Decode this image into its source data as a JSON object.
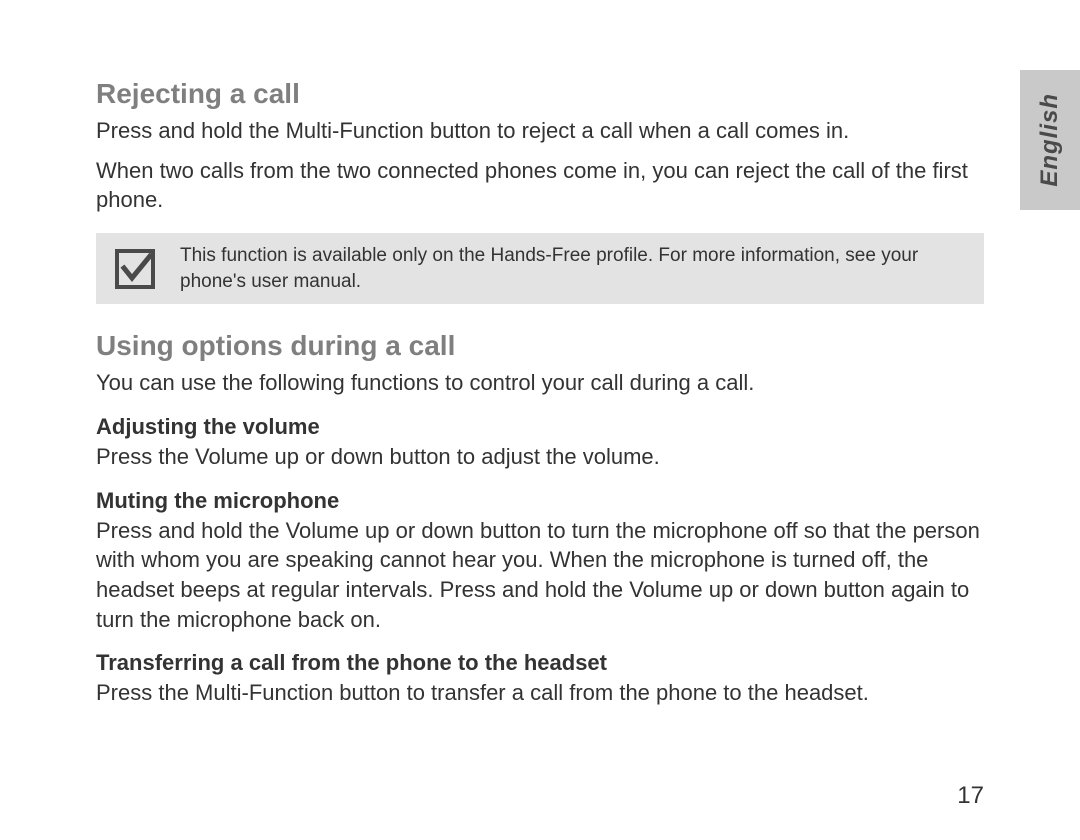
{
  "language_tab": "English",
  "sec1": {
    "heading": "Rejecting a call",
    "p1": "Press and hold the Multi-Function button to reject a call when a call comes in.",
    "p2": "When two calls from the two connected phones come in, you can reject the call of the first phone."
  },
  "note": {
    "text": "This function is available only on the Hands-Free profile. For more information, see your phone's user manual."
  },
  "sec2": {
    "heading": "Using options during a call",
    "intro": "You can use the following functions to control your call during a call.",
    "sub1": {
      "heading": "Adjusting the volume",
      "body": "Press the Volume up or down button to adjust the volume."
    },
    "sub2": {
      "heading": "Muting the microphone",
      "body": "Press and hold the Volume up or down button to turn the microphone off so that the person with whom you are speaking cannot hear you. When the microphone is turned off, the headset beeps at regular intervals. Press and hold the Volume up or down button again to turn the microphone back on."
    },
    "sub3": {
      "heading": "Transferring a call from the phone to the headset",
      "body": "Press the Multi-Function button to transfer a call from the phone to the headset."
    }
  },
  "page_number": "17"
}
